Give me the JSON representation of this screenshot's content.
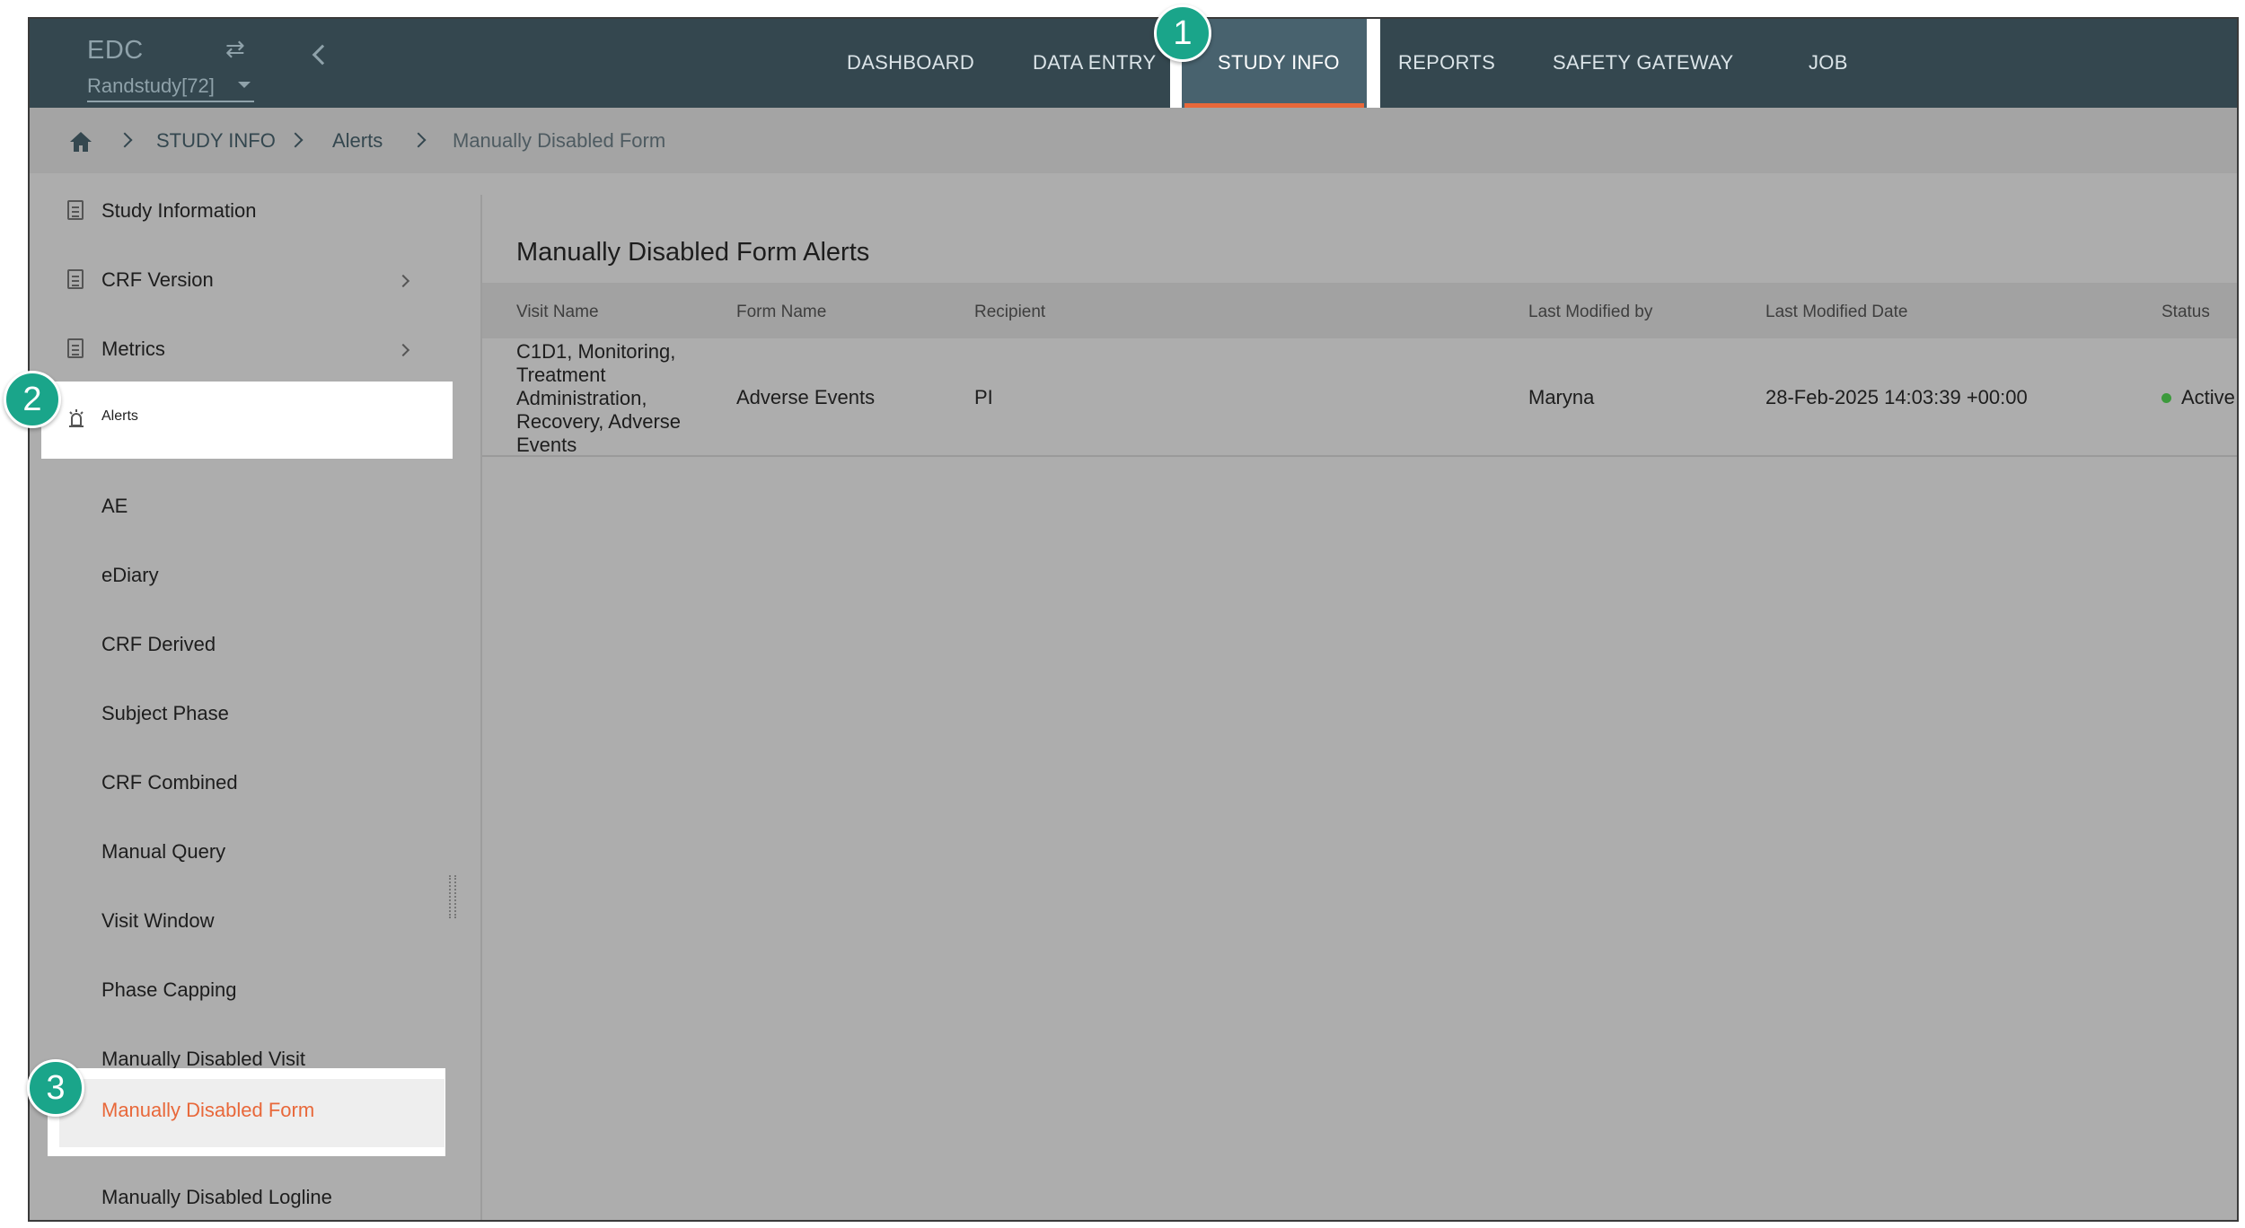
{
  "header": {
    "brand": "EDC",
    "study": "Randstudy[72]"
  },
  "nav": {
    "items": [
      "DASHBOARD",
      "DATA ENTRY",
      "STUDY INFO",
      "REPORTS",
      "SAFETY GATEWAY",
      "JOB"
    ],
    "active": "STUDY INFO"
  },
  "breadcrumb": {
    "items": [
      "STUDY INFO",
      "Alerts",
      "Manually Disabled Form"
    ]
  },
  "sidebar": {
    "items": [
      "Study Information",
      "CRF Version",
      "Metrics",
      "Alerts"
    ],
    "alerts_children": [
      "AE",
      "eDiary",
      "CRF Derived",
      "Subject Phase",
      "CRF Combined",
      "Manual Query",
      "Visit Window",
      "Phase Capping",
      "Manually Disabled Visit",
      "Manually Disabled Form",
      "Manually Disabled Logline"
    ],
    "active_child": "Manually Disabled Form"
  },
  "main": {
    "title": "Manually Disabled Form Alerts",
    "columns": [
      "Visit Name",
      "Form Name",
      "Recipient",
      "Last Modified by",
      "Last Modified Date",
      "Status"
    ],
    "rows": [
      {
        "visit_name": "C1D1, Monitoring, Treatment Administration, Recovery, Adverse Events",
        "form_name": "Adverse Events",
        "recipient": "PI",
        "last_modified_by": "Maryna",
        "last_modified_date": "28-Feb-2025 14:03:39 +00:00",
        "status": "Active"
      }
    ]
  },
  "callouts": [
    "1",
    "2",
    "3"
  ],
  "colors": {
    "topbar": "#34474f",
    "accent": "#e8683a",
    "badge": "#1aa58a",
    "status_active": "#3c9a3c"
  }
}
